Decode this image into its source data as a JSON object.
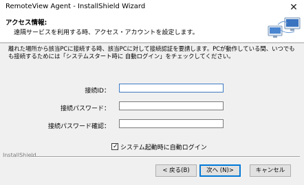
{
  "window": {
    "title": "RemoteView Agent - InstallShield Wizard",
    "close_glyph": "✕"
  },
  "banner": {
    "heading": "アクセス情報:",
    "subtitle": "遠隔サービスを利用する時、アクセス・アカウントを設定します。",
    "graphic_icon": "computers-network-icon"
  },
  "description": {
    "line1": "離れた場所から該当PCに接続する時、該当PCに対して接続認証を要請します。PCが動作している間、いつでも",
    "line2": "も接続するためには「システムスタート時に 自動ログイン」をチェックしてください。"
  },
  "form": {
    "connection_id_label": "接続ID：",
    "connection_id_value": "",
    "password_label": "接続パスワード：",
    "password_value": "",
    "password_confirm_label": "接続パスワード確認：",
    "password_confirm_value": ""
  },
  "auto_login": {
    "label": "システム起動時に自動ログイン",
    "checked": true
  },
  "footer": {
    "brand": "InstallShield",
    "back_label": "< 戻る(B)",
    "next_label": "次へ (N)>",
    "cancel_label": "キャンセル"
  },
  "colors": {
    "focus_border": "#3b78c4",
    "default_button_border": "#0078d7",
    "dialog_background": "#f0f0f0"
  }
}
